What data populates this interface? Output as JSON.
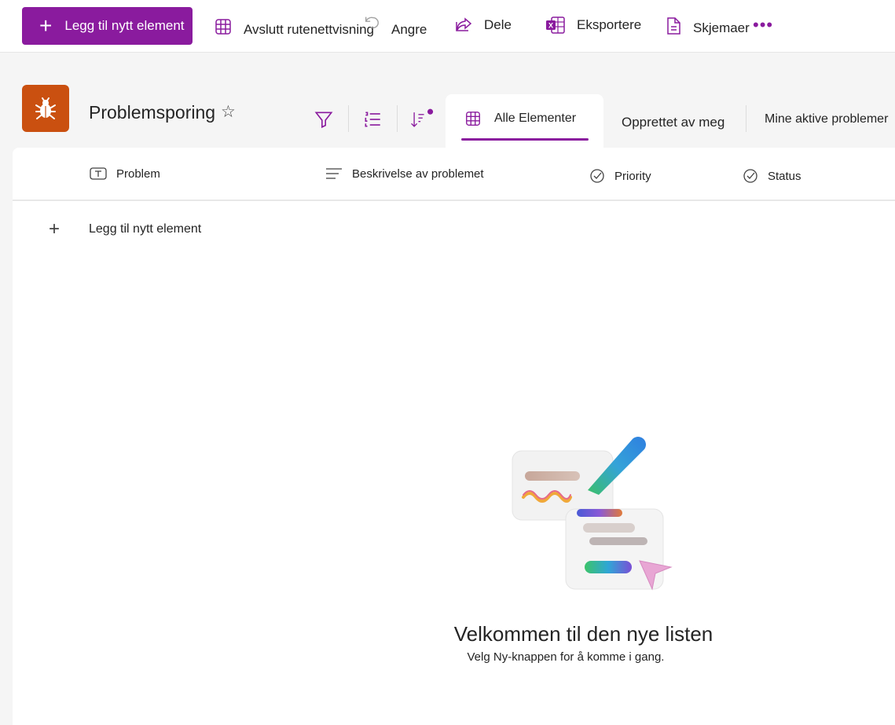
{
  "commandbar": {
    "new_item": "Legg til nytt element",
    "exit_grid": "Avslutt rutenettvisning",
    "undo": "Angre",
    "share": "Dele",
    "export": "Eksportere",
    "forms": "Skjemaer",
    "more": "•••"
  },
  "header": {
    "list_title": "Problemsporing",
    "star": "☆"
  },
  "views": {
    "active": "Alle Elementer",
    "tab2": "Opprettet av meg",
    "tab3": "Mine aktive problemer"
  },
  "columns": [
    {
      "label": "Problem",
      "icon": "text-field-icon"
    },
    {
      "label": "Beskrivelse av problemet",
      "icon": "multiline-text-icon"
    },
    {
      "label": "Priority",
      "icon": "choice-check-icon"
    },
    {
      "label": "Status",
      "icon": "choice-check-icon"
    }
  ],
  "list": {
    "add_item": "Legg til nytt element"
  },
  "empty_state": {
    "title": "Velkommen til den nye listen",
    "subtitle": "Velg Ny-knappen for å komme i gang."
  },
  "colors": {
    "accent": "#8a1b9e",
    "app_icon": "#ca5010"
  }
}
